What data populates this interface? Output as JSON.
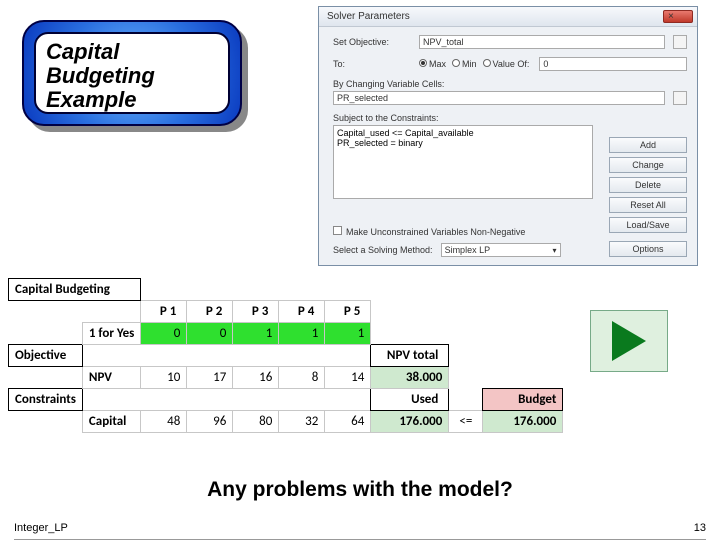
{
  "title_lines": {
    "l1": "Capital",
    "l2": "Budgeting",
    "l3": "Example"
  },
  "solver": {
    "window_title": "Solver Parameters",
    "close": "×",
    "set_objective_label": "Set Objective:",
    "set_objective_value": "NPV_total",
    "to_label": "To:",
    "radio_max": "Max",
    "radio_min": "Min",
    "radio_valueof": "Value Of:",
    "value_of": "0",
    "changing_label": "By Changing Variable Cells:",
    "changing_value": "PR_selected",
    "constraints_label": "Subject to the Constraints:",
    "constraint_lines": {
      "c1": "Capital_used <= Capital_available",
      "c2": "PR_selected = binary"
    },
    "btn_add": "Add",
    "btn_change": "Change",
    "btn_delete": "Delete",
    "btn_reset": "Reset All",
    "btn_load": "Load/Save",
    "chk_nonneg": "Make Unconstrained Variables Non-Negative",
    "method_label": "Select a Solving Method:",
    "method_value": "Simplex LP",
    "btn_options": "Options"
  },
  "sheet": {
    "section_top": "Capital Budgeting",
    "section_obj": "Objective",
    "section_con": "Constraints",
    "row_select": "1 for Yes",
    "row_npv": "NPV",
    "row_capital": "Capital",
    "headers": {
      "p1": "P 1",
      "p2": "P 2",
      "p3": "P 3",
      "p4": "P 4",
      "p5": "P 5"
    },
    "sel": {
      "p1": "0",
      "p2": "0",
      "p3": "1",
      "p4": "1",
      "p5": "1"
    },
    "npv": {
      "p1": "10",
      "p2": "17",
      "p3": "16",
      "p4": "8",
      "p5": "14"
    },
    "cap": {
      "p1": "48",
      "p2": "96",
      "p3": "80",
      "p4": "32",
      "p5": "64"
    },
    "npv_total_label": "NPV total",
    "npv_total": "38.000",
    "used_label": "Used",
    "used": "176.000",
    "leq": "<=",
    "budget_label": "Budget",
    "budget": "176.000"
  },
  "question": "Any problems with the model?",
  "footer": {
    "left": "Integer_LP",
    "right": "13"
  }
}
